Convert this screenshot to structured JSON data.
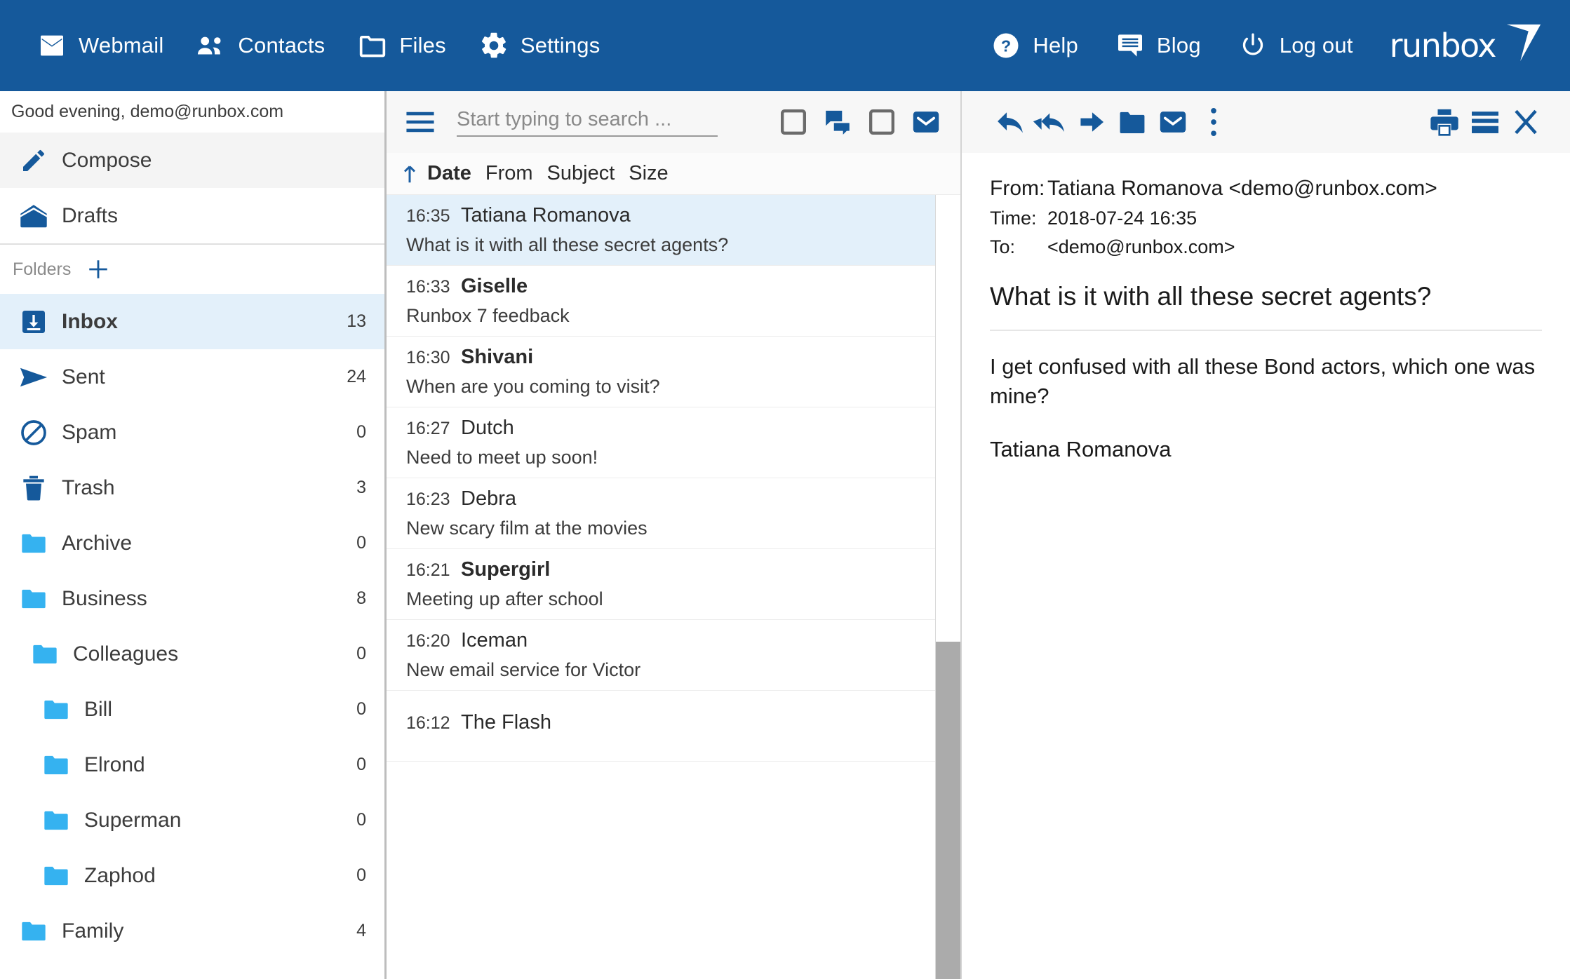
{
  "topnav": {
    "left_items": [
      {
        "icon": "mail-icon",
        "label": "Webmail"
      },
      {
        "icon": "contacts-icon",
        "label": "Contacts"
      },
      {
        "icon": "folder-icon",
        "label": "Files"
      },
      {
        "icon": "gear-icon",
        "label": "Settings"
      }
    ],
    "right_items": [
      {
        "icon": "help-icon",
        "label": "Help"
      },
      {
        "icon": "blog-icon",
        "label": "Blog"
      },
      {
        "icon": "power-icon",
        "label": "Log out"
      }
    ],
    "logo_text": "runbox",
    "brand_color": "#15599b"
  },
  "sidebar": {
    "greeting": "Good evening, demo@runbox.com",
    "compose_label": "Compose",
    "drafts_label": "Drafts",
    "folders_label": "Folders",
    "add_folder_icon": "plus-icon",
    "folders": [
      {
        "icon": "inbox-icon",
        "label": "Inbox",
        "count": "13",
        "indent": 0,
        "selected": true,
        "bold": true
      },
      {
        "icon": "sent-icon",
        "label": "Sent",
        "count": "24",
        "indent": 0,
        "selected": false,
        "bold": false
      },
      {
        "icon": "spam-icon",
        "label": "Spam",
        "count": "0",
        "indent": 0,
        "selected": false,
        "bold": false
      },
      {
        "icon": "trash-icon",
        "label": "Trash",
        "count": "3",
        "indent": 0,
        "selected": false,
        "bold": false
      },
      {
        "icon": "folder-icon",
        "label": "Archive",
        "count": "0",
        "indent": 0,
        "selected": false,
        "bold": false
      },
      {
        "icon": "folder-icon",
        "label": "Business",
        "count": "8",
        "indent": 0,
        "selected": false,
        "bold": false
      },
      {
        "icon": "folder-icon",
        "label": "Colleagues",
        "count": "0",
        "indent": 1,
        "selected": false,
        "bold": false
      },
      {
        "icon": "folder-icon",
        "label": "Bill",
        "count": "0",
        "indent": 2,
        "selected": false,
        "bold": false
      },
      {
        "icon": "folder-icon",
        "label": "Elrond",
        "count": "0",
        "indent": 2,
        "selected": false,
        "bold": false
      },
      {
        "icon": "folder-icon",
        "label": "Superman",
        "count": "0",
        "indent": 2,
        "selected": false,
        "bold": false
      },
      {
        "icon": "folder-icon",
        "label": "Zaphod",
        "count": "0",
        "indent": 2,
        "selected": false,
        "bold": false
      },
      {
        "icon": "folder-icon",
        "label": "Family",
        "count": "4",
        "indent": 0,
        "selected": false,
        "bold": false
      }
    ]
  },
  "maillist": {
    "menu_icon": "hamburger-icon",
    "search_placeholder": "Start typing to search ...",
    "search_value": "",
    "toolbar_icons": [
      {
        "name": "unselected-checkbox-icon",
        "state": "off"
      },
      {
        "name": "conversation-icon",
        "state": "on"
      },
      {
        "name": "unselected-checkbox-icon-2",
        "state": "off"
      },
      {
        "name": "unread-mail-icon",
        "state": "on"
      }
    ],
    "sort_arrow_icon": "sort-ascending-arrow-icon",
    "columns": [
      {
        "label": "Date",
        "active": true
      },
      {
        "label": "From",
        "active": false
      },
      {
        "label": "Subject",
        "active": false
      },
      {
        "label": "Size",
        "active": false
      }
    ],
    "messages": [
      {
        "time": "16:35",
        "from": "Tatiana Romanova",
        "subject": "What is it with all these secret agents?",
        "unread": false,
        "selected": true
      },
      {
        "time": "16:33",
        "from": "Giselle",
        "subject": "Runbox 7 feedback",
        "unread": true,
        "selected": false
      },
      {
        "time": "16:30",
        "from": "Shivani",
        "subject": "When are you coming to visit?",
        "unread": true,
        "selected": false
      },
      {
        "time": "16:27",
        "from": "Dutch",
        "subject": "Need to meet up soon!",
        "unread": false,
        "selected": false
      },
      {
        "time": "16:23",
        "from": "Debra",
        "subject": "New scary film at the movies",
        "unread": false,
        "selected": false
      },
      {
        "time": "16:21",
        "from": "Supergirl",
        "subject": "Meeting up after school",
        "unread": true,
        "selected": false
      },
      {
        "time": "16:20",
        "from": "Iceman",
        "subject": "New email service for Victor",
        "unread": false,
        "selected": false
      },
      {
        "time": "16:12",
        "from": "The Flash",
        "subject": "",
        "unread": false,
        "selected": false
      }
    ],
    "scrollbar": {
      "thumb_top_pct": 57,
      "thumb_height_pct": 43
    }
  },
  "reader": {
    "toolbar_icons": [
      {
        "name": "reply-icon"
      },
      {
        "name": "reply-all-icon"
      },
      {
        "name": "forward-icon"
      },
      {
        "name": "move-to-folder-icon"
      },
      {
        "name": "mark-unread-icon"
      },
      {
        "name": "more-options-icon"
      },
      {
        "name": "print-icon"
      },
      {
        "name": "view-mode-icon"
      },
      {
        "name": "close-icon"
      }
    ],
    "from_key": "From:",
    "from_value": "Tatiana Romanova <demo@runbox.com>",
    "time_key": "Time:",
    "time_value": "2018-07-24 16:35",
    "to_key": "To:",
    "to_value": "<demo@runbox.com>",
    "subject": "What is it with all these secret agents?",
    "body_paragraph_1": "I get confused with all these Bond actors, which one was mine?",
    "body_paragraph_2": "Tatiana Romanova"
  }
}
